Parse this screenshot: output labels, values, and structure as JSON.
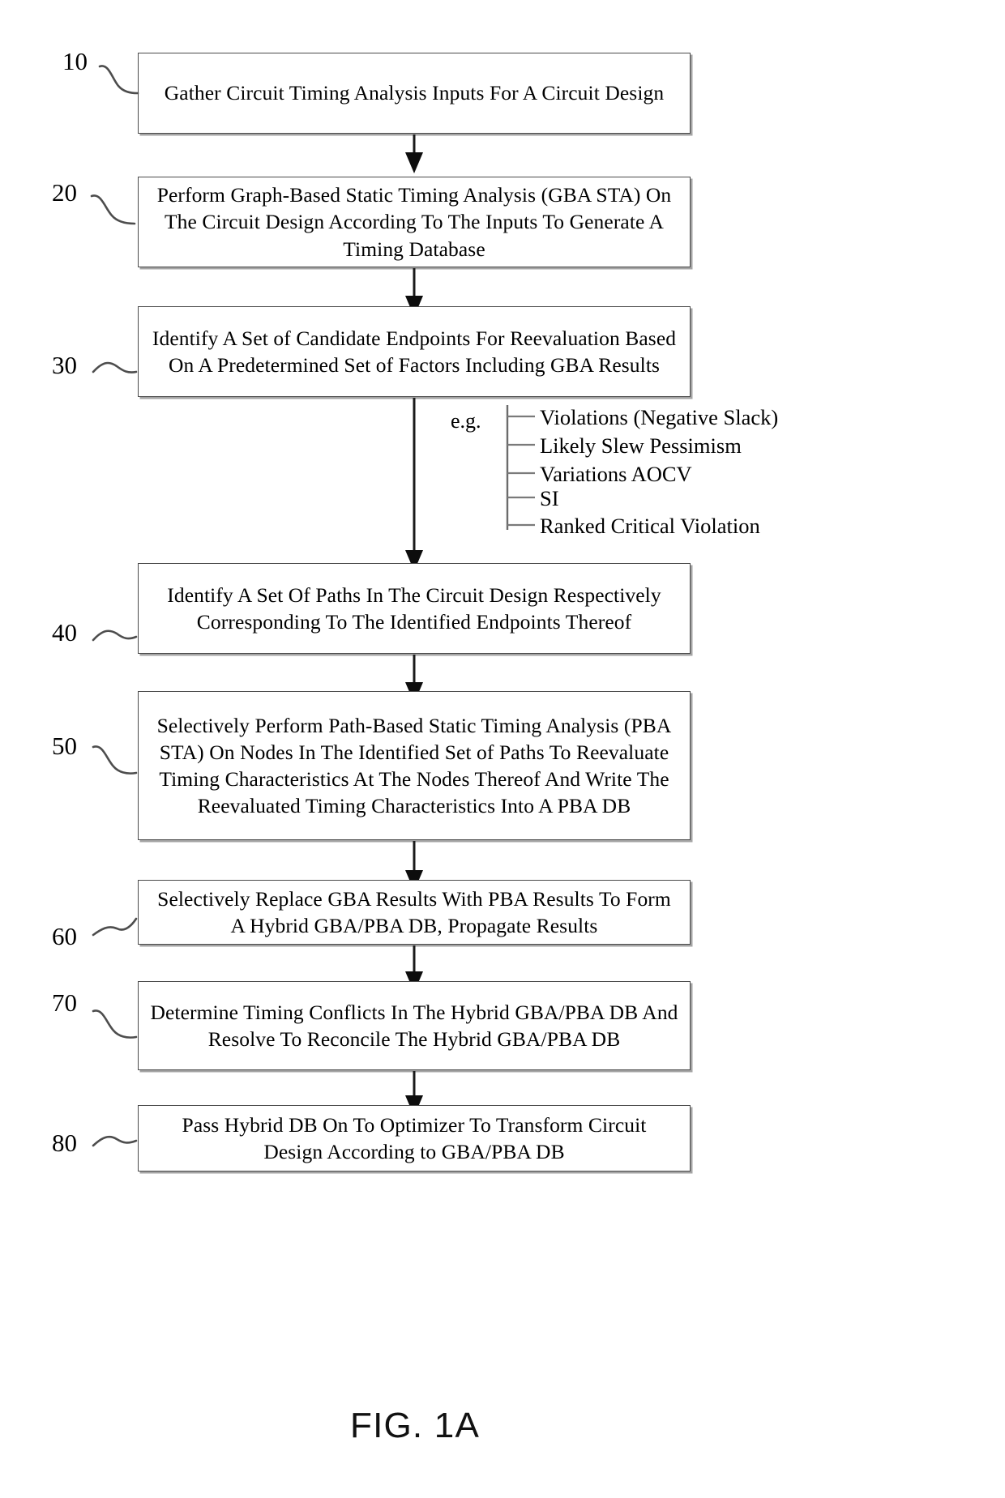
{
  "figure": {
    "caption": "FIG. 1A"
  },
  "flowchart": {
    "steps": [
      {
        "ref": "10",
        "text": "Gather Circuit Timing Analysis Inputs For A Circuit Design",
        "name": "step-gather-inputs"
      },
      {
        "ref": "20",
        "text": "Perform Graph-Based Static Timing Analysis (GBA STA) On The Circuit Design According To The Inputs To Generate A Timing Database",
        "name": "step-perform-gba-sta"
      },
      {
        "ref": "30",
        "text": "Identify A Set of Candidate Endpoints For Reevaluation Based On A Predetermined Set of Factors Including GBA Results",
        "name": "step-identify-candidate-endpoints"
      },
      {
        "ref": "40",
        "text": "Identify A Set Of Paths In The Circuit Design Respectively Corresponding To The Identified Endpoints Thereof",
        "name": "step-identify-paths"
      },
      {
        "ref": "50",
        "text": "Selectively Perform Path-Based Static Timing Analysis (PBA STA) On Nodes In The Identified Set of Paths To Reevaluate Timing Characteristics At The Nodes Thereof And Write The Reevaluated Timing Characteristics Into A PBA DB",
        "name": "step-perform-pba-sta"
      },
      {
        "ref": "60",
        "text": "Selectively Replace GBA Results With PBA Results To Form A Hybrid GBA/PBA DB, Propagate Results",
        "name": "step-replace-gba-with-pba"
      },
      {
        "ref": "70",
        "text": "Determine Timing Conflicts In The Hybrid GBA/PBA DB And Resolve To Reconcile The Hybrid GBA/PBA DB",
        "name": "step-resolve-timing-conflicts"
      },
      {
        "ref": "80",
        "text": "Pass Hybrid DB On To Optimizer To Transform Circuit Design According to GBA/PBA DB",
        "name": "step-pass-hybrid-db-to-optimizer"
      }
    ]
  },
  "annotation": {
    "label": "e.g.",
    "items": [
      "Violations (Negative Slack)",
      "Likely Slew Pessimism",
      "Variations AOCV",
      "SI",
      "Ranked Critical Violation"
    ]
  },
  "colors": {
    "box_border": "#4a4a4a",
    "arrow": "#0d0d0d",
    "leader": "#4d4d4d",
    "bracket": "#6b6b6b",
    "text": "#000000",
    "background": "#ffffff"
  }
}
